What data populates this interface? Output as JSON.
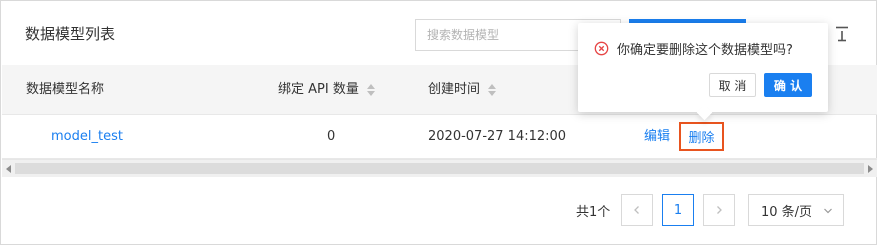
{
  "header": {
    "title": "数据模型列表",
    "search_placeholder": "搜索数据模型"
  },
  "table": {
    "columns": [
      {
        "label": "数据模型名称",
        "sortable": false
      },
      {
        "label": "绑定 API 数量",
        "sortable": true
      },
      {
        "label": "创建时间",
        "sortable": true
      }
    ],
    "rows": [
      {
        "name": "model_test",
        "api_count": "0",
        "created": "2020-07-27 14:12:00",
        "edit": "编辑",
        "delete": "删除"
      }
    ]
  },
  "popconfirm": {
    "message": "你确定要删除这个数据模型吗?",
    "cancel": "取 消",
    "ok": "确 认"
  },
  "pagination": {
    "total": "共1个",
    "current_page": "1",
    "page_size": "10 条/页"
  },
  "colors": {
    "primary": "#1a7ff0",
    "danger": "#e8541f",
    "highlight_border": "#e8541f"
  }
}
